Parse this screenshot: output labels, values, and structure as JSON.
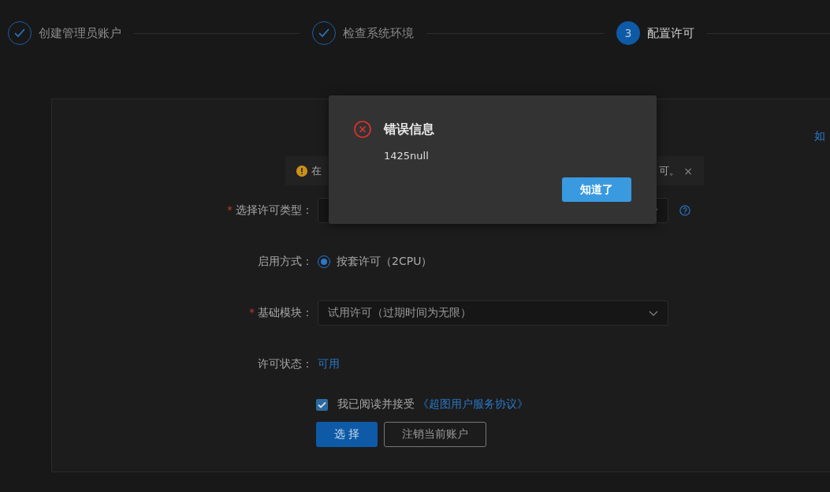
{
  "steps": [
    {
      "label": "创建管理员账户",
      "completed": true
    },
    {
      "label": "检查系统环境",
      "completed": true
    },
    {
      "label": "配置许可",
      "completed": false,
      "number": "3"
    }
  ],
  "help_link": "如",
  "alert": {
    "text_start": "在",
    "text_end": "可。",
    "close": "×"
  },
  "form": {
    "fields": [
      {
        "kind": "select",
        "label": "选择许可类型：",
        "required_mark": "*",
        "help": true
      },
      {
        "kind": "radio",
        "label": "启用方式：",
        "option": "按套许可（2CPU）",
        "selected": true
      },
      {
        "kind": "select",
        "label": "基础模块：",
        "required_mark": "*",
        "value": "试用许可（过期时间为无限）"
      },
      {
        "kind": "status",
        "label": "许可状态：",
        "value": "可用"
      }
    ],
    "agreement": {
      "checked": true,
      "text": "我已阅读并接受",
      "link": "《超图用户服务协议》"
    },
    "buttons": [
      {
        "label": "选 择",
        "kind": "primary"
      },
      {
        "label": "注销当前账户",
        "kind": "secondary"
      }
    ]
  },
  "dialog": {
    "title": "错误信息",
    "message": "1425null",
    "button": "知道了"
  }
}
